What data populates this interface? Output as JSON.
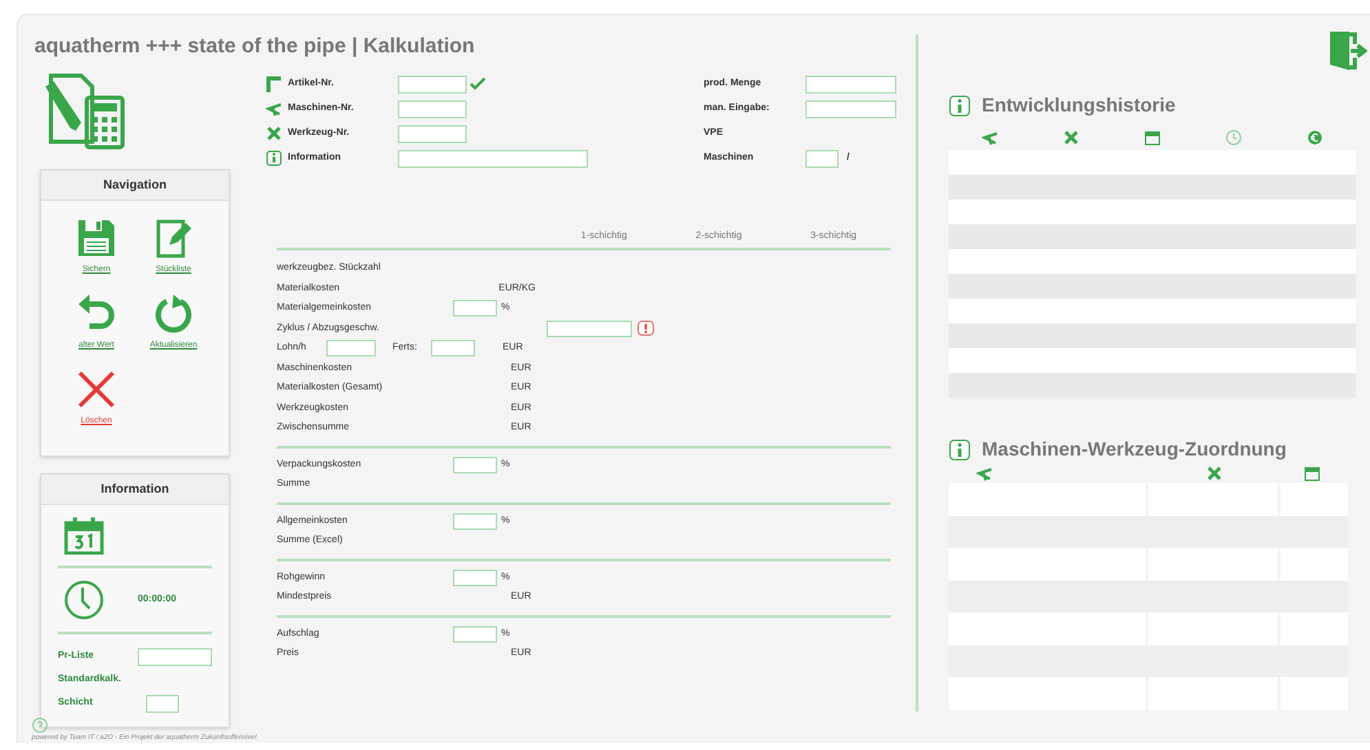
{
  "title": "aquatherm +++ state of the pipe | Kalkulation",
  "id_fields": [
    {
      "kind": "article",
      "label": "Artikel-Nr.",
      "validated": true
    },
    {
      "kind": "machine",
      "label": "Maschinen-Nr.",
      "validated": false
    },
    {
      "kind": "tool",
      "label": "Werkzeug-Nr.",
      "validated": false
    },
    {
      "kind": "info",
      "label": "Information",
      "validated": false
    }
  ],
  "quantity_fields": [
    {
      "label": "prod. Menge",
      "kind": "wide"
    },
    {
      "label": "man. Eingabe:",
      "kind": "wide"
    },
    {
      "label": "VPE",
      "kind": "none"
    },
    {
      "label": "Maschinen",
      "kind": "small",
      "suffix": "/"
    }
  ],
  "navigation": {
    "title": "Navigation",
    "buttons": [
      {
        "kind": "save",
        "label": "Sichern"
      },
      {
        "kind": "parts",
        "label": "Stückliste"
      },
      {
        "kind": "undo",
        "label": "alter Wert"
      },
      {
        "kind": "refresh",
        "label": "Aktualisieren"
      },
      {
        "kind": "delete",
        "label": "Löschen"
      }
    ]
  },
  "information": {
    "title": "Information",
    "time": "00:00:00",
    "rows": [
      {
        "label": "Pr-Liste",
        "kind": "wide"
      },
      {
        "label": "Standardkalk.",
        "kind": "none"
      },
      {
        "label": "Schicht",
        "kind": "small"
      }
    ]
  },
  "calculation": {
    "columns": [
      "1-schichtig",
      "2-schichtig",
      "3-schichtig"
    ],
    "sections": [
      [
        {
          "kind": "plain",
          "label": "werkzeugbez. Stückzahl"
        },
        {
          "kind": "plain",
          "label": "Materialkosten",
          "unit": "EUR/KG"
        },
        {
          "kind": "percent",
          "label": "Materialgemeinkosten",
          "unit": "%"
        },
        {
          "kind": "cycle",
          "label": "Zyklus / Abzugsgeschw.",
          "warning": true
        },
        {
          "kind": "labor",
          "label": "Lohn/h",
          "second_label": "Ferts:",
          "unit": "EUR"
        },
        {
          "kind": "plain",
          "label": "Maschinenkosten",
          "unit": "EUR"
        },
        {
          "kind": "plain",
          "label": "Materialkosten (Gesamt)",
          "unit": "EUR"
        },
        {
          "kind": "plain",
          "label": "Werkzeugkosten",
          "unit": "EUR"
        },
        {
          "kind": "plain",
          "label": "Zwischensumme",
          "unit": "EUR"
        }
      ],
      [
        {
          "kind": "percent",
          "label": "Verpackungskosten",
          "unit": "%"
        },
        {
          "kind": "plain",
          "label": "Summe"
        }
      ],
      [
        {
          "kind": "percent",
          "label": "Allgemeinkosten",
          "unit": "%"
        },
        {
          "kind": "plain",
          "label": "Summe (Excel)"
        }
      ],
      [
        {
          "kind": "percent",
          "label": "Rohgewinn",
          "unit": "%"
        },
        {
          "kind": "plain",
          "label": "Mindestpreis",
          "unit": "EUR"
        }
      ],
      [
        {
          "kind": "percent",
          "label": "Aufschlag",
          "unit": "%"
        },
        {
          "kind": "plain",
          "label": "Preis",
          "unit": "EUR"
        }
      ]
    ]
  },
  "history": {
    "title": "Entwicklungshistorie",
    "columns": [
      {
        "kind": "machine"
      },
      {
        "kind": "tool"
      },
      {
        "kind": "calendar"
      },
      {
        "kind": "clock"
      },
      {
        "kind": "euro"
      }
    ]
  },
  "assignment": {
    "title": "Maschinen-Werkzeug-Zuordnung",
    "columns": [
      {
        "kind": "machine"
      },
      {
        "kind": "tool"
      },
      {
        "kind": "calendar"
      }
    ]
  },
  "footer": "powered by Team IT / a2O - Ein Projekt der aquatherm Zukunftsoffensive!"
}
